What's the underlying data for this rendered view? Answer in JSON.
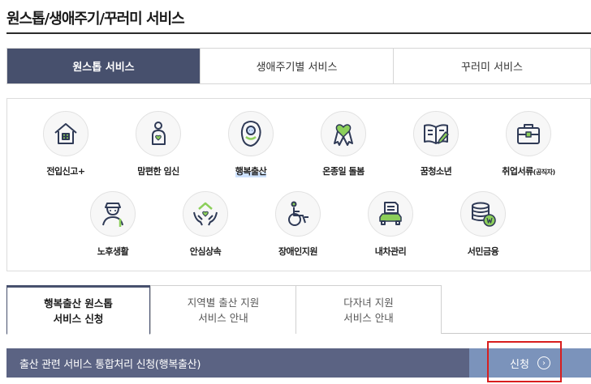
{
  "page": {
    "title": "원스톱/생애주기/꾸러미 서비스"
  },
  "main_tabs": [
    {
      "label": "원스톱 서비스",
      "active": true
    },
    {
      "label": "생애주기별 서비스",
      "active": false
    },
    {
      "label": "꾸러미 서비스",
      "active": false
    }
  ],
  "services": [
    {
      "label": "전입신고+",
      "icon": "house-icon"
    },
    {
      "label": "맘편한 임신",
      "icon": "pregnant-icon"
    },
    {
      "label": "행복출산",
      "icon": "baby-icon",
      "highlighted": true
    },
    {
      "label": "온종일 돌봄",
      "icon": "ribbon-heart-icon"
    },
    {
      "label": "꿈청소년",
      "icon": "book-pen-icon"
    },
    {
      "label": "취업서류",
      "label_suffix": "(공직자)",
      "icon": "briefcase-icon"
    },
    {
      "label": "노후생활",
      "icon": "elderly-icon"
    },
    {
      "label": "안심상속",
      "icon": "hands-house-icon"
    },
    {
      "label": "장애인지원",
      "icon": "wheelchair-icon"
    },
    {
      "label": "내차관리",
      "icon": "car-document-icon"
    },
    {
      "label": "서민금융",
      "icon": "coins-icon"
    }
  ],
  "sub_tabs": [
    {
      "line1": "행복출산 원스톱",
      "line2": "서비스 신청",
      "active": true
    },
    {
      "line1": "지역별 출산 지원",
      "line2": "서비스 안내",
      "active": false
    },
    {
      "line1": "다자녀 지원",
      "line2": "서비스 안내",
      "active": false
    }
  ],
  "apply_bar": {
    "text": "출산 관련 서비스 통합처리 신청(행복출산)",
    "button_label": "신청",
    "button_icon": "circle-arrow-right-icon"
  },
  "colors": {
    "accent_dark": "#47506d",
    "bar": "#5b6383",
    "button": "#7b93bb",
    "highlight_box": "#d81e1e",
    "icon_stroke": "#2f3a56",
    "icon_fill": "#8ccf5a"
  }
}
